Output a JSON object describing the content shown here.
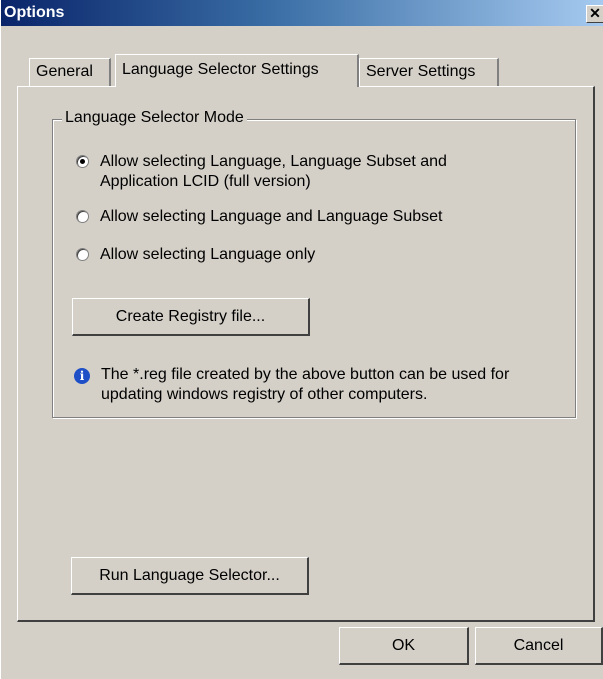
{
  "window": {
    "title": "Options",
    "close_glyph": "✕"
  },
  "tabs": [
    {
      "label": "General",
      "active": false
    },
    {
      "label": "Language Selector Settings",
      "active": true
    },
    {
      "label": "Server Settings",
      "active": false
    }
  ],
  "group": {
    "label": "Language Selector Mode",
    "options": [
      {
        "label": "Allow selecting Language, Language Subset and Application LCID (full version)",
        "checked": true
      },
      {
        "label": "Allow selecting Language and Language Subset",
        "checked": false
      },
      {
        "label": "Allow selecting Language only",
        "checked": false
      }
    ],
    "create_registry_label": "Create Registry file...",
    "info_text": "The *.reg file created by the above button can be used for updating windows registry of other computers.",
    "info_icon": "i"
  },
  "run_selector_label": "Run Language Selector...",
  "footer": {
    "ok_label": "OK",
    "cancel_label": "Cancel"
  }
}
